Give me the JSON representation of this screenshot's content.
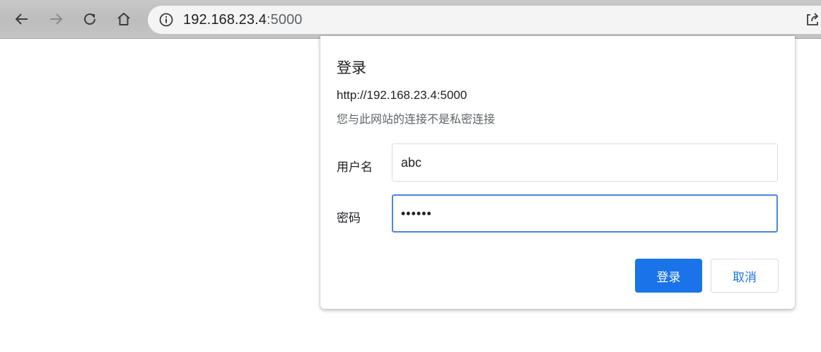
{
  "browser": {
    "back_icon": "arrow-left-icon",
    "forward_icon": "arrow-right-icon",
    "reload_icon": "reload-icon",
    "home_icon": "home-icon",
    "info_icon": "info-icon",
    "share_icon": "share-icon",
    "url_host": "192.168.23.4",
    "url_port": ":5000"
  },
  "dialog": {
    "title": "登录",
    "origin": "http://192.168.23.4:5000",
    "warning": "您与此网站的连接不是私密连接",
    "username_label": "用户名",
    "username_value": "abc",
    "password_label": "密码",
    "password_value": "••••••",
    "submit_label": "登录",
    "cancel_label": "取消"
  },
  "colors": {
    "accent": "#1a73e8",
    "focus_border": "#4a86e3"
  }
}
